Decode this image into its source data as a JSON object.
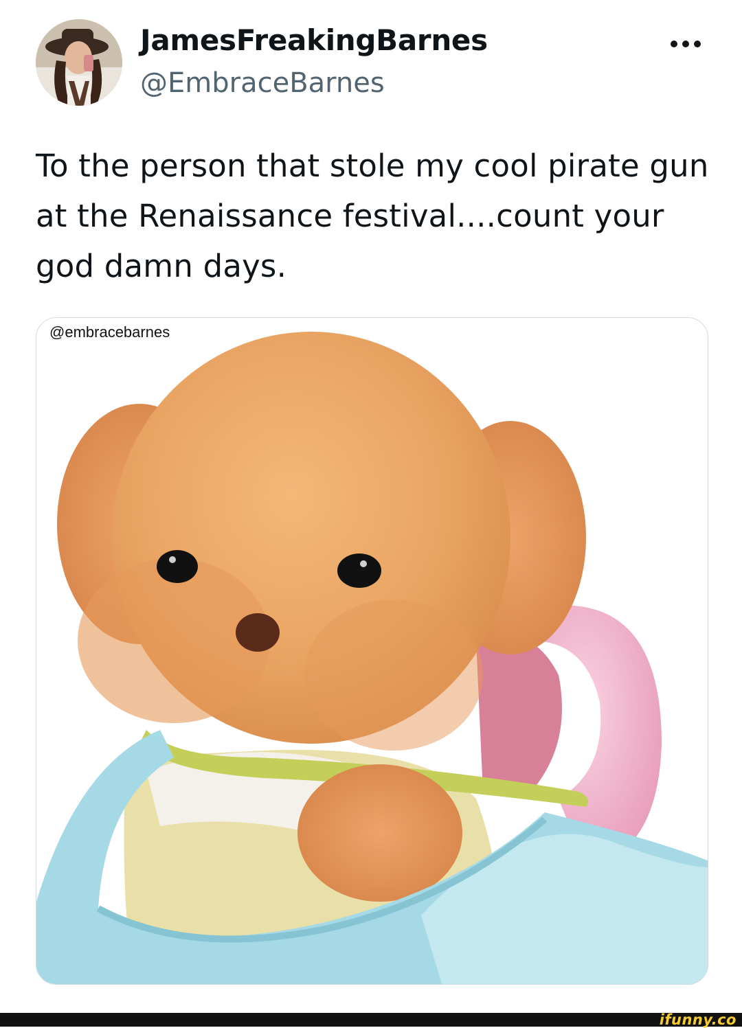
{
  "tweet": {
    "author": {
      "display_name": "JamesFreakingBarnes",
      "handle": "@EmbraceBarnes"
    },
    "text": "To the person that stole my cool pirate gun at the Renaissance festival....count your god damn days.",
    "media": {
      "overlay_handle": "@embracebarnes",
      "description_icon": "angry-plush-puppy-image"
    }
  },
  "footer": {
    "brand": "ifunny.co"
  },
  "colors": {
    "text": "#0f1419",
    "secondary_text": "#536471",
    "border": "#cfd9de",
    "footer_bg": "#111111",
    "brand_yellow": "#f6cb2c"
  }
}
